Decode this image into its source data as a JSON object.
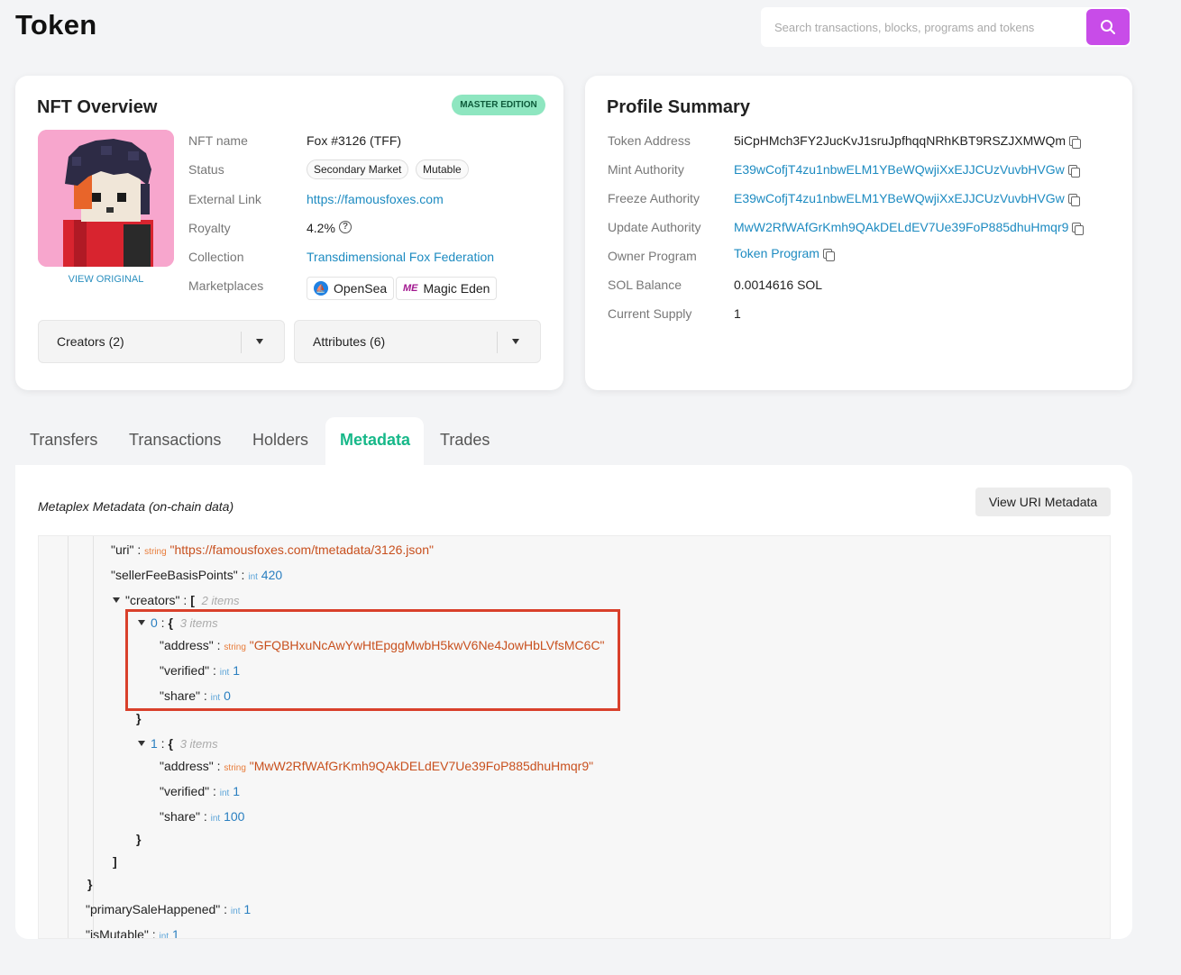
{
  "header": {
    "title": "Token",
    "search_placeholder": "Search transactions, blocks, programs and tokens"
  },
  "nft_overview": {
    "title": "NFT Overview",
    "badge": "MASTER EDITION",
    "view_original": "VIEW ORIGINAL",
    "labels": {
      "name": "NFT name",
      "status": "Status",
      "external_link": "External Link",
      "royalty": "Royalty",
      "collection": "Collection",
      "marketplaces": "Marketplaces"
    },
    "values": {
      "name": "Fox #3126 (TFF)",
      "status_tags": [
        "Secondary Market",
        "Mutable"
      ],
      "external_link": "https://famousfoxes.com",
      "royalty": "4.2%",
      "collection": "Transdimensional Fox Federation",
      "marketplaces": [
        "OpenSea",
        "Magic Eden"
      ]
    },
    "creators_dropdown": "Creators (2)",
    "attributes_dropdown": "Attributes (6)"
  },
  "profile_summary": {
    "title": "Profile Summary",
    "rows": [
      {
        "label": "Token Address",
        "value": "5iCpHMch3FY2JucKvJ1sruJpfhqqNRhKBT9RSZJXMWQm"
      },
      {
        "label": "Mint Authority",
        "value": "E39wCofjT4zu1nbwELM1YBeWQwjiXxEJJCUzVuvbHVGw"
      },
      {
        "label": "Freeze Authority",
        "value": "E39wCofjT4zu1nbwELM1YBeWQwjiXxEJJCUzVuvbHVGw"
      },
      {
        "label": "Update Authority",
        "value": "MwW2RfWAfGrKmh9QAkDELdEV7Ue39FoP885dhuHmqr9"
      },
      {
        "label": "Owner Program",
        "value": "Token Program"
      },
      {
        "label": "SOL Balance",
        "value": "0.0014616 SOL"
      },
      {
        "label": "Current Supply",
        "value": "1"
      }
    ]
  },
  "tabs": [
    "Transfers",
    "Transactions",
    "Holders",
    "Metadata",
    "Trades"
  ],
  "active_tab": "Metadata",
  "metadata": {
    "heading": "Metaplex Metadata (on-chain data)",
    "view_uri_button": "View URI Metadata",
    "json": {
      "uri_key": "\"uri\"",
      "uri_value": "\"https://famousfoxes.com/tmetadata/3126.json\"",
      "seller_key": "\"sellerFeeBasisPoints\"",
      "seller_value": "420",
      "creators_key": "\"creators\"",
      "creators_count": "2 items",
      "creator_items": [
        {
          "index": "0",
          "count": "3 items",
          "address": "\"GFQBHxuNcAwYwHtEpggMwbH5kwV6Ne4JowHbLVfsMC6C\"",
          "verified": "1",
          "share": "0"
        },
        {
          "index": "1",
          "count": "3 items",
          "address": "\"MwW2RfWAfGrKmh9QAkDELdEV7Ue39FoP885dhuHmqr9\"",
          "verified": "1",
          "share": "100"
        }
      ],
      "address_key": "\"address\"",
      "verified_key": "\"verified\"",
      "share_key": "\"share\"",
      "primary_key": "\"primarySaleHappened\"",
      "primary_value": "1",
      "mutable_key": "\"isMutable\"",
      "mutable_value": "1",
      "type_string": "string",
      "type_int": "int"
    }
  },
  "colors": {
    "accent": "#c84ce8",
    "link": "#1d8bc1",
    "active_tab": "#17b889",
    "highlight": "#d9402b"
  }
}
